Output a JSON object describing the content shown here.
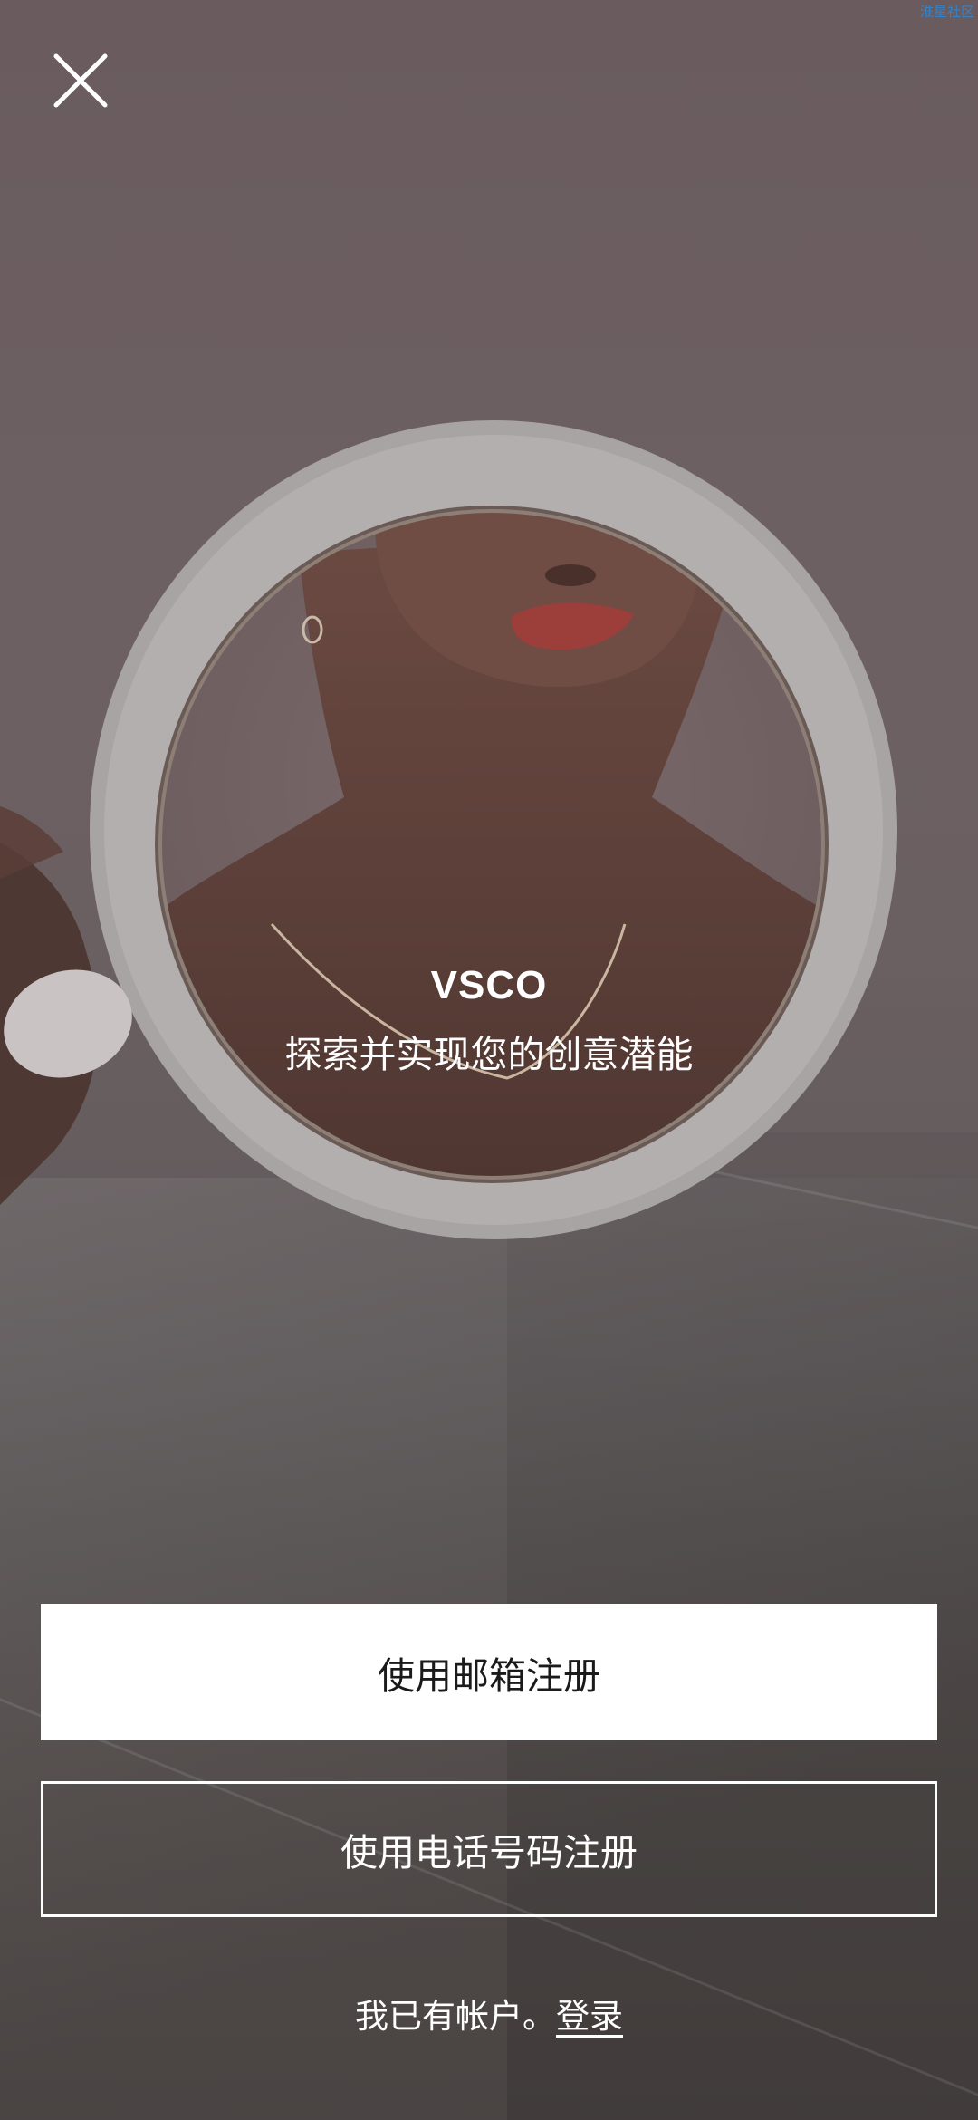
{
  "watermark": "淮星社区",
  "close": {
    "icon": "close-icon"
  },
  "brand": {
    "title": "VSCO",
    "tagline": "探索并实现您的创意潜能"
  },
  "actions": {
    "email_signup": "使用邮箱注册",
    "phone_signup": "使用电话号码注册"
  },
  "login": {
    "prompt": "我已有帐户。",
    "link": "登录"
  },
  "colors": {
    "overlay": "#5a4f50",
    "button_fill": "#ffffff",
    "text": "#ffffff",
    "watermark": "#2f88d6"
  }
}
